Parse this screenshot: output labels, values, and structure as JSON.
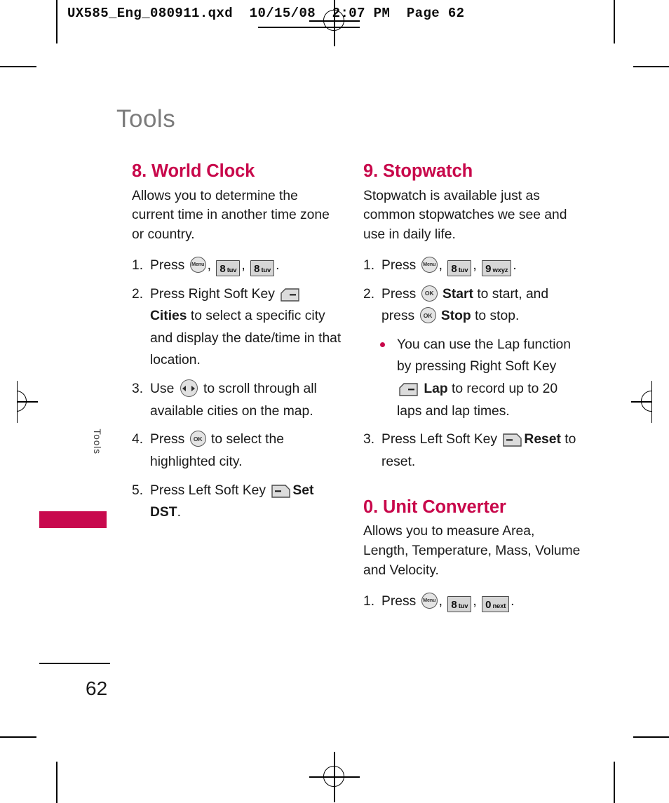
{
  "slug": {
    "text": "UX585_Eng_080911.qxd  10/15/08  2:07 PM  Page 62"
  },
  "chapter": {
    "title": "Tools",
    "side_tab_label": "Tools"
  },
  "footer": {
    "page_number": "62"
  },
  "colors": {
    "accent": "#c8084b",
    "chapter_title": "#7b7b7b",
    "body_text": "#1a1a1a",
    "key_fill": "#d6d6d6"
  },
  "left_column": {
    "section": {
      "heading": "8. World Clock",
      "intro": "Allows you to determine the current time in another time zone or country.",
      "steps": [
        {
          "num": "1.",
          "pre": "Press",
          "keys": [
            "menu-key",
            "8-tuv-key",
            "8-tuv-key"
          ],
          "post": "."
        },
        {
          "num": "2.",
          "text_a": "Press Right Soft Key",
          "icon": "right-soft-key",
          "bold": "Cities",
          "text_b": "to select a specific city and display the date/time in that location."
        },
        {
          "num": "3.",
          "text_a": "Use",
          "icon": "navigation-key",
          "text_b": "to scroll through all available cities on the map."
        },
        {
          "num": "4.",
          "text_a": "Press",
          "icon": "ok-key",
          "text_b": "to select the highlighted city."
        },
        {
          "num": "5.",
          "text_a": "Press Left Soft Key",
          "icon": "left-soft-key",
          "bold": "Set DST",
          "text_b": "."
        }
      ]
    }
  },
  "right_column": {
    "sections": [
      {
        "heading": "9. Stopwatch",
        "intro": "Stopwatch is available just as common stopwatches we see and use in daily life.",
        "steps": [
          {
            "num": "1.",
            "pre": "Press",
            "keys": [
              "menu-key",
              "8-tuv-key",
              "9-wxyz-key"
            ],
            "post": "."
          },
          {
            "num": "2.",
            "text_a": "Press",
            "icon_a": "ok-key",
            "bold_a": "Start",
            "text_b": "to start, and press",
            "icon_b": "ok-key",
            "bold_b": "Stop",
            "text_c": "to stop."
          },
          {
            "bullet": true,
            "text_a": "You can use the Lap function by pressing Right Soft Key",
            "icon": "right-soft-key",
            "bold": "Lap",
            "text_b": "to record up to 20 laps and lap times."
          },
          {
            "num": "3.",
            "text_a": "Press Left Soft Key",
            "icon": "left-soft-key",
            "bold": "Reset",
            "text_b": "to reset."
          }
        ]
      },
      {
        "heading": "0. Unit Converter",
        "intro": "Allows you to measure Area, Length, Temperature, Mass, Volume and Velocity.",
        "steps": [
          {
            "num": "1.",
            "pre": "Press",
            "keys": [
              "menu-key",
              "8-tuv-key",
              "0-next-key"
            ],
            "post": "."
          }
        ]
      }
    ]
  },
  "keys": {
    "menu": {
      "label": "Menu"
    },
    "ok": {
      "label": "OK"
    },
    "k8": {
      "digit": "8",
      "letters": "tuv"
    },
    "k9": {
      "digit": "9",
      "letters": "wxyz"
    },
    "k0": {
      "digit": "0",
      "letters": "next"
    }
  }
}
